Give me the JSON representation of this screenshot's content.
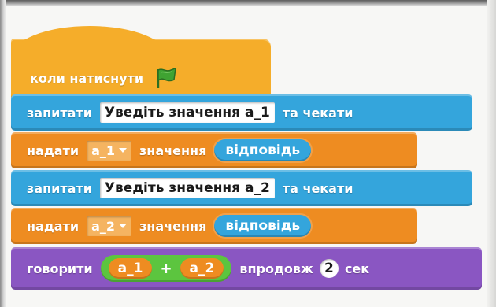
{
  "script": {
    "hat": {
      "label": "коли натиснути",
      "icon": "green-flag-icon"
    },
    "ask1": {
      "label": "запитати",
      "input": "Уведіть значення а_1",
      "suffix": "та чекати"
    },
    "set1": {
      "label": "надати",
      "variable": "а_1",
      "middle": "значення",
      "value": "відповідь"
    },
    "ask2": {
      "label": "запитати",
      "input": "Уведіть значення а_2",
      "suffix": "та чекати"
    },
    "set2": {
      "label": "надати",
      "variable": "а_2",
      "middle": "значення",
      "value": "відповідь"
    },
    "say": {
      "label": "говорити",
      "left": "а_1",
      "operator": "+",
      "right": "а_2",
      "middle": "впродовж",
      "seconds": "2",
      "unit": "сек"
    }
  },
  "colors": {
    "events": "#f5ad2a",
    "sensing": "#34a5dc",
    "data": "#ee8c21",
    "operators": "#5cc53f",
    "looks": "#8a56c2",
    "flag": "#3fa332"
  }
}
